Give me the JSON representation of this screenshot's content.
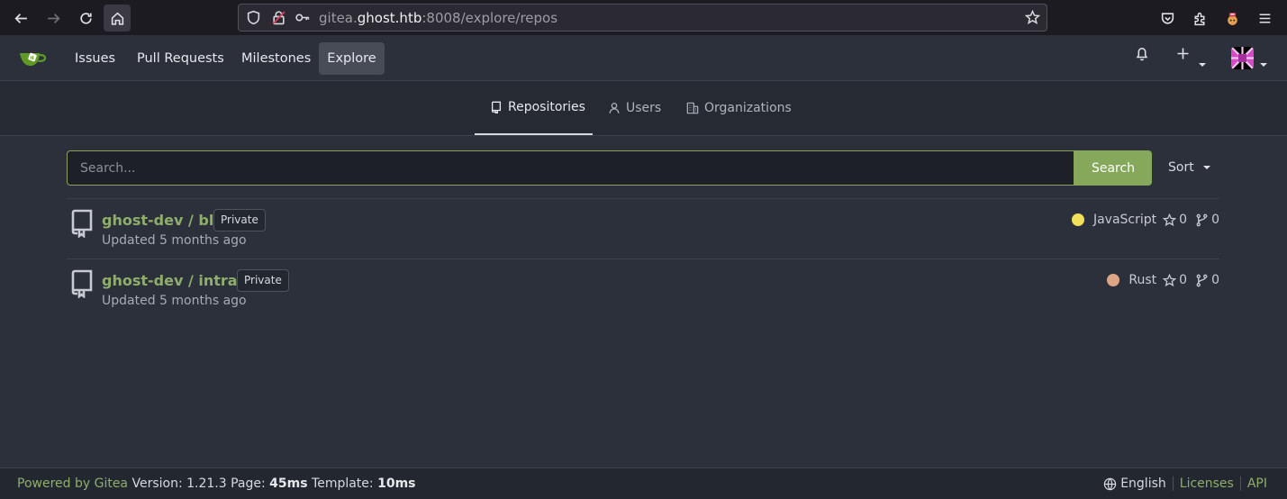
{
  "browser": {
    "url_prefix": "gitea.",
    "url_host": "ghost.htb",
    "url_suffix": ":8008/explore/repos"
  },
  "navbar": {
    "items": [
      {
        "label": "Issues"
      },
      {
        "label": "Pull Requests"
      },
      {
        "label": "Milestones"
      },
      {
        "label": "Explore",
        "active": true
      }
    ]
  },
  "tabs": [
    {
      "label": "Repositories",
      "active": true
    },
    {
      "label": "Users"
    },
    {
      "label": "Organizations"
    }
  ],
  "search": {
    "placeholder": "Search...",
    "button_label": "Search",
    "sort_label": "Sort"
  },
  "repos": [
    {
      "name": "ghost-dev / blog",
      "badge": "Private",
      "updated": "Updated 5 months ago",
      "language": "JavaScript",
      "language_color": "#f1e05a",
      "stars": "0",
      "forks": "0"
    },
    {
      "name": "ghost-dev / intranet",
      "badge": "Private",
      "updated": "Updated 5 months ago",
      "language": "Rust",
      "language_color": "#dea584",
      "stars": "0",
      "forks": "0"
    }
  ],
  "footer": {
    "powered_by": "Powered by Gitea",
    "version_text": "Version: 1.21.3 Page:",
    "page_time": "45ms",
    "template_label": "Template:",
    "template_time": "10ms",
    "language": "English",
    "licenses": "Licenses",
    "api": "API"
  },
  "colors": {
    "accent": "#86a85a",
    "link": "#8fae6b"
  }
}
